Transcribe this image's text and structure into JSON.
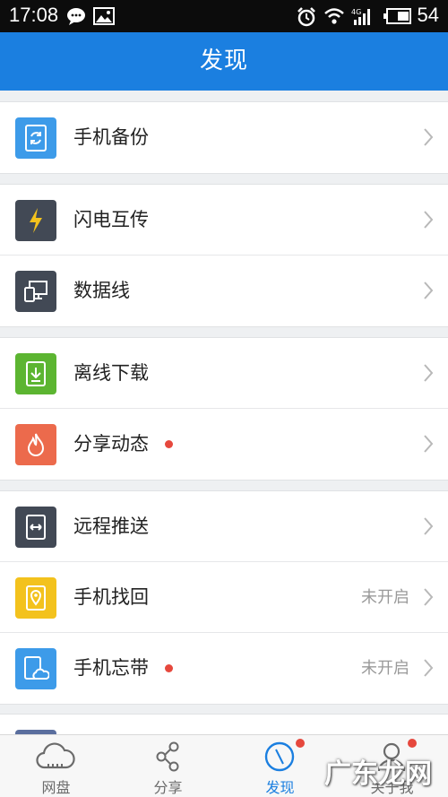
{
  "status_bar": {
    "time": "17:08",
    "battery": "54",
    "network": "4G",
    "icons": [
      "chat-bubble-icon",
      "image-icon",
      "alarm-icon",
      "wifi-icon",
      "signal-icon",
      "battery-icon"
    ]
  },
  "header": {
    "title": "发现"
  },
  "groups": [
    {
      "items": [
        {
          "label": "手机备份",
          "icon": "backup-icon",
          "color": "#3d9be9",
          "status": "",
          "dot": false
        }
      ]
    },
    {
      "items": [
        {
          "label": "闪电互传",
          "icon": "lightning-icon",
          "color": "#424955",
          "status": "",
          "dot": false
        },
        {
          "label": "数据线",
          "icon": "devices-icon",
          "color": "#424955",
          "status": "",
          "dot": false
        }
      ]
    },
    {
      "items": [
        {
          "label": "离线下载",
          "icon": "download-icon",
          "color": "#5cb531",
          "status": "",
          "dot": false
        },
        {
          "label": "分享动态",
          "icon": "flame-icon",
          "color": "#ec6a4c",
          "status": "",
          "dot": true
        }
      ]
    },
    {
      "items": [
        {
          "label": "远程推送",
          "icon": "push-icon",
          "color": "#424955",
          "status": "",
          "dot": false
        },
        {
          "label": "手机找回",
          "icon": "locate-icon",
          "color": "#f3c21d",
          "status": "未开启",
          "dot": false
        },
        {
          "label": "手机忘带",
          "icon": "phone-cloud-icon",
          "color": "#3d9be9",
          "status": "未开启",
          "dot": true
        }
      ]
    }
  ],
  "tabs": [
    {
      "label": "网盘",
      "icon": "cloud-icon",
      "active": false,
      "badge": false
    },
    {
      "label": "分享",
      "icon": "share-icon",
      "active": false,
      "badge": false
    },
    {
      "label": "发现",
      "icon": "compass-icon",
      "active": true,
      "badge": true
    },
    {
      "label": "关于我",
      "icon": "person-icon",
      "active": false,
      "badge": true
    }
  ],
  "watermark": "广东龙网",
  "colors": {
    "accent": "#1b7fe0",
    "badge": "#e6483d"
  }
}
